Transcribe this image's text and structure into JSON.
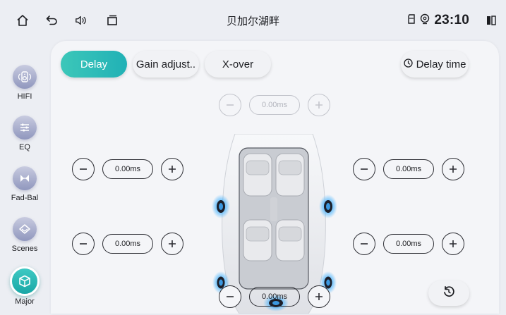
{
  "status_bar": {
    "title": "贝加尔湖畔",
    "time": "23:10",
    "icons": [
      "home-icon",
      "back-icon",
      "volume-icon",
      "recent-apps-icon",
      "sd-card-icon",
      "location-icon",
      "split-screen-icon"
    ]
  },
  "sidebar": {
    "items": [
      {
        "label": "HIFI",
        "icon": "speaker-icon",
        "active": false
      },
      {
        "label": "EQ",
        "icon": "equalizer-icon",
        "active": false
      },
      {
        "label": "Fad-Bal",
        "icon": "fader-balance-icon",
        "active": false
      },
      {
        "label": "Scenes",
        "icon": "scenes-icon",
        "active": false
      },
      {
        "label": "Major",
        "icon": "cube-icon",
        "active": true
      }
    ]
  },
  "tabs": [
    {
      "label": "Delay",
      "active": true
    },
    {
      "label": "Gain adjust..",
      "active": false
    },
    {
      "label": "X-over",
      "active": false
    }
  ],
  "delay_time_button": {
    "label": "Delay time",
    "icon": "clock-icon"
  },
  "delay": {
    "center_top": "0.00ms",
    "front_left": "0.00ms",
    "front_right": "0.00ms",
    "rear_left": "0.00ms",
    "rear_right": "0.00ms",
    "subwoofer": "0.00ms"
  },
  "colors": {
    "accent": "#21b1b6",
    "sidebar_icon": "#9097be",
    "speaker_glow": "#2aa8ff",
    "background": "#eceef3"
  }
}
